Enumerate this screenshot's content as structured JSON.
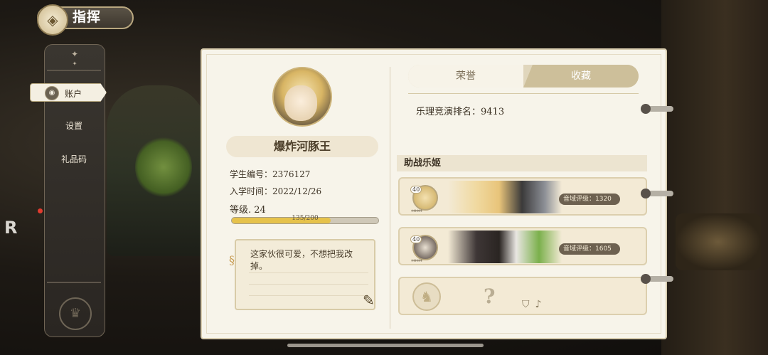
{
  "header": {
    "title": "指挥",
    "emblem_icon": "diamond-compass-icon"
  },
  "nav": {
    "items": [
      {
        "label": "账户",
        "active": true
      },
      {
        "label": "设置",
        "active": false
      },
      {
        "label": "礼品码",
        "active": false
      }
    ]
  },
  "overlay": {
    "logo": "R"
  },
  "profile": {
    "name": "爆炸河豚王",
    "student_id": "学生编号：2376127",
    "enroll_date": "入学时间：2022/12/26",
    "level": "等级. 24",
    "xp_text": "135/200",
    "xp_current": 135,
    "xp_max": 200,
    "note": "这家伙很可爱，不想把我改掉。"
  },
  "tabs": [
    {
      "label": "荣誉",
      "selected": false
    },
    {
      "label": "收藏",
      "selected": true
    }
  ],
  "rank": "乐理竞演排名：9413",
  "support": {
    "title": "助战乐姬",
    "cards": [
      {
        "level": "40",
        "stars": "******",
        "badge": "音域评级：1320"
      },
      {
        "level": "40",
        "stars": "******",
        "badge": "音域评级：1605"
      }
    ],
    "empty_slot": "?"
  },
  "colors": {
    "accent": "#cdbf9a",
    "panel": "#f7f4ea",
    "xp_fill": "#e6c24b",
    "notification": "#e23b2f"
  }
}
